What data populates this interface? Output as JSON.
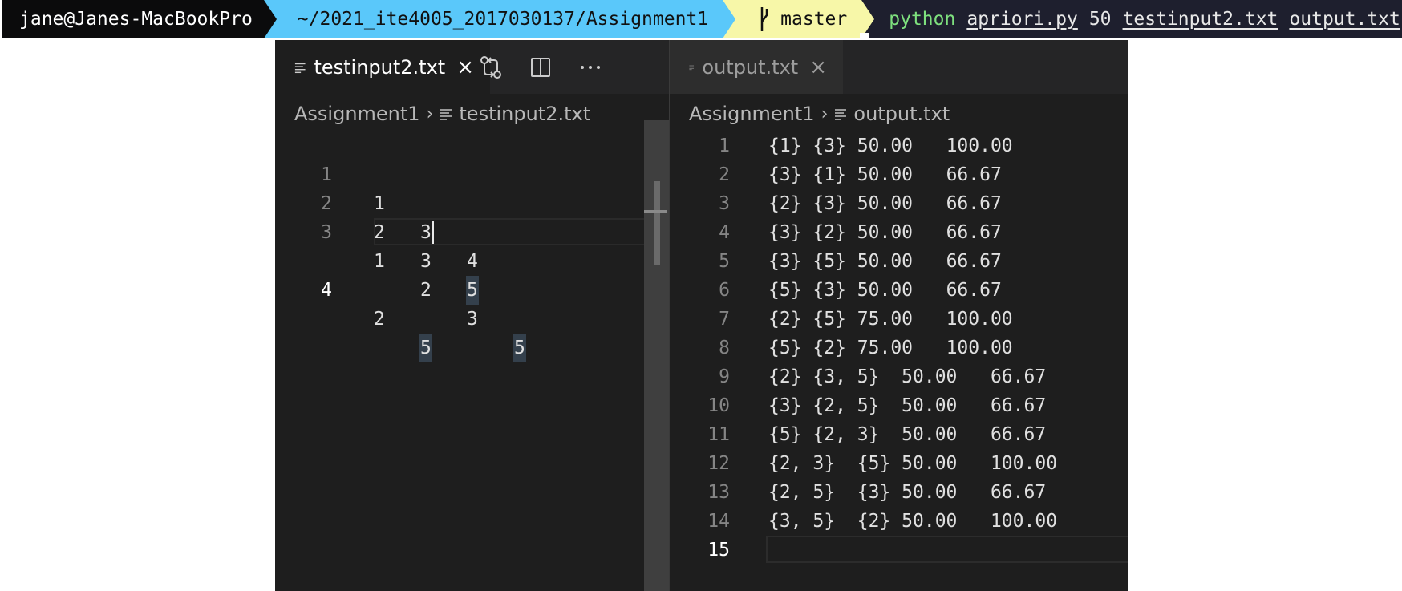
{
  "prompt": {
    "user": "jane@Janes-MacBookPro",
    "path": "~/2021_ite4005_2017030137/Assignment1",
    "branch": "master",
    "command": {
      "program": "python",
      "script": "apriori.py",
      "arg_support": "50",
      "input_file": "testinput2.txt",
      "output_file": "output.txt"
    }
  },
  "left_pane": {
    "tab_label": "testinput2.txt",
    "breadcrumb": [
      "Assignment1",
      "testinput2.txt"
    ],
    "lines": [
      {
        "num": "1",
        "tokens": [
          "1",
          "3",
          "4"
        ]
      },
      {
        "num": "2",
        "tokens": [
          "2",
          "3",
          "5"
        ]
      },
      {
        "num": "3",
        "tokens": [
          "1",
          "2",
          "3",
          "5"
        ]
      },
      {
        "num": "4",
        "tokens": [
          "2",
          "5"
        ]
      }
    ]
  },
  "right_pane": {
    "tab_label": "output.txt",
    "breadcrumb": [
      "Assignment1",
      "output.txt"
    ],
    "lines": [
      {
        "num": "1",
        "text": "{1} {3} 50.00\t100.00"
      },
      {
        "num": "2",
        "text": "{3} {1} 50.00\t66.67"
      },
      {
        "num": "3",
        "text": "{2} {3} 50.00\t66.67"
      },
      {
        "num": "4",
        "text": "{3} {2} 50.00\t66.67"
      },
      {
        "num": "5",
        "text": "{3} {5} 50.00\t66.67"
      },
      {
        "num": "6",
        "text": "{5} {3} 50.00\t66.67"
      },
      {
        "num": "7",
        "text": "{2} {5} 75.00\t100.00"
      },
      {
        "num": "8",
        "text": "{5} {2} 75.00\t100.00"
      },
      {
        "num": "9",
        "text": "{2} {3, 5}  50.00\t66.67"
      },
      {
        "num": "10",
        "text": "{3} {2, 5}  50.00\t66.67"
      },
      {
        "num": "11",
        "text": "{5} {2, 3}  50.00\t66.67"
      },
      {
        "num": "12",
        "text": "{2, 3}  {5} 50.00\t100.00"
      },
      {
        "num": "13",
        "text": "{2, 5}  {3} 50.00\t66.67"
      },
      {
        "num": "14",
        "text": "{3, 5}  {2} 50.00\t100.00"
      },
      {
        "num": "15",
        "text": ""
      }
    ]
  },
  "icons": {
    "tab_file": "lines-icon",
    "compare": "git-compare-icon",
    "split": "split-editor-icon",
    "more": "ellipsis-icon",
    "close": "close-icon",
    "branch": "git-branch-icon"
  }
}
